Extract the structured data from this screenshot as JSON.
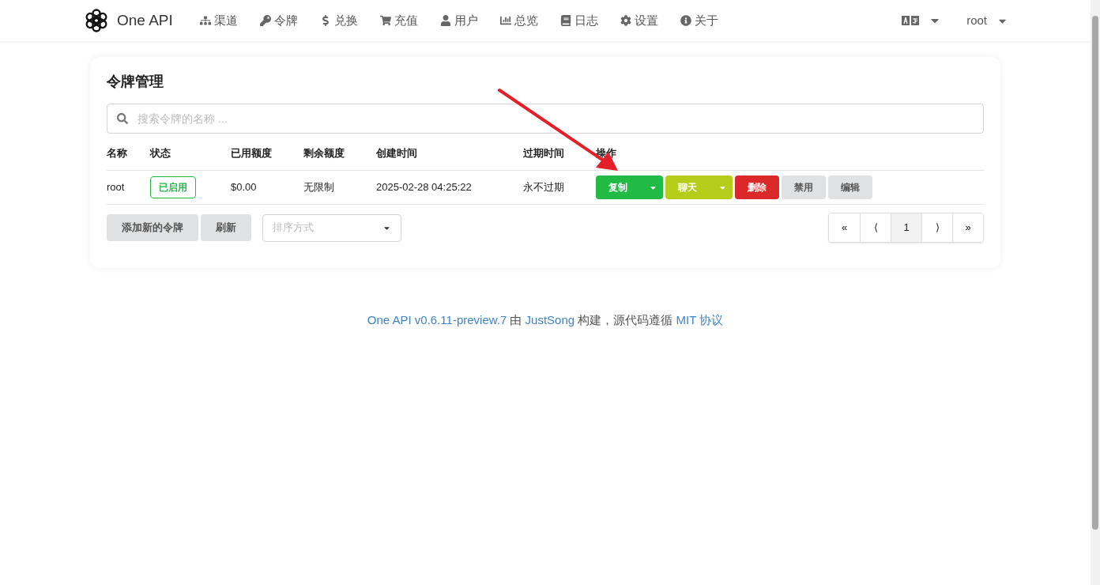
{
  "header": {
    "brand": "One API",
    "nav": [
      {
        "label": "渠道"
      },
      {
        "label": "令牌"
      },
      {
        "label": "兑换"
      },
      {
        "label": "充值"
      },
      {
        "label": "用户"
      },
      {
        "label": "总览"
      },
      {
        "label": "日志"
      },
      {
        "label": "设置"
      },
      {
        "label": "关于"
      }
    ],
    "user": "root"
  },
  "card": {
    "title": "令牌管理",
    "search": {
      "placeholder": "搜索令牌的名称 ..."
    },
    "columns": [
      "名称",
      "状态",
      "已用额度",
      "剩余额度",
      "创建时间",
      "过期时间",
      "操作"
    ],
    "rows": [
      {
        "name": "root",
        "status": {
          "label": "已启用",
          "color": "#21ba45"
        },
        "used": "$0.00",
        "remaining": "无限制",
        "created": "2025-02-28 04:25:22",
        "expires": "永不过期",
        "actions": [
          {
            "label": "复制",
            "color": "#21ba45",
            "has_menu": true
          },
          {
            "label": "聊天",
            "color": "#b5cc18",
            "has_menu": true
          },
          {
            "label": "删除",
            "color": "#db2828",
            "has_menu": false
          },
          {
            "label": "禁用",
            "color": "#e0e1e2",
            "has_menu": false
          },
          {
            "label": "编辑",
            "color": "#e0e1e2",
            "has_menu": false
          }
        ]
      }
    ],
    "buttons": [
      "添加新的令牌",
      "刷新"
    ],
    "sort": {
      "placeholder": "排序方式"
    },
    "pagination": [
      {
        "label": "«",
        "selected": false
      },
      {
        "label": "⟨",
        "selected": false
      },
      {
        "label": "1",
        "selected": true
      },
      {
        "label": "⟩",
        "selected": false
      },
      {
        "label": "»",
        "selected": false
      }
    ]
  },
  "footer": {
    "project_link": "One API v0.6.11-preview.7",
    "by": "由",
    "author_link": "JustSong",
    "middle": "构建，源代码遵循",
    "license_link": "MIT 协议"
  }
}
